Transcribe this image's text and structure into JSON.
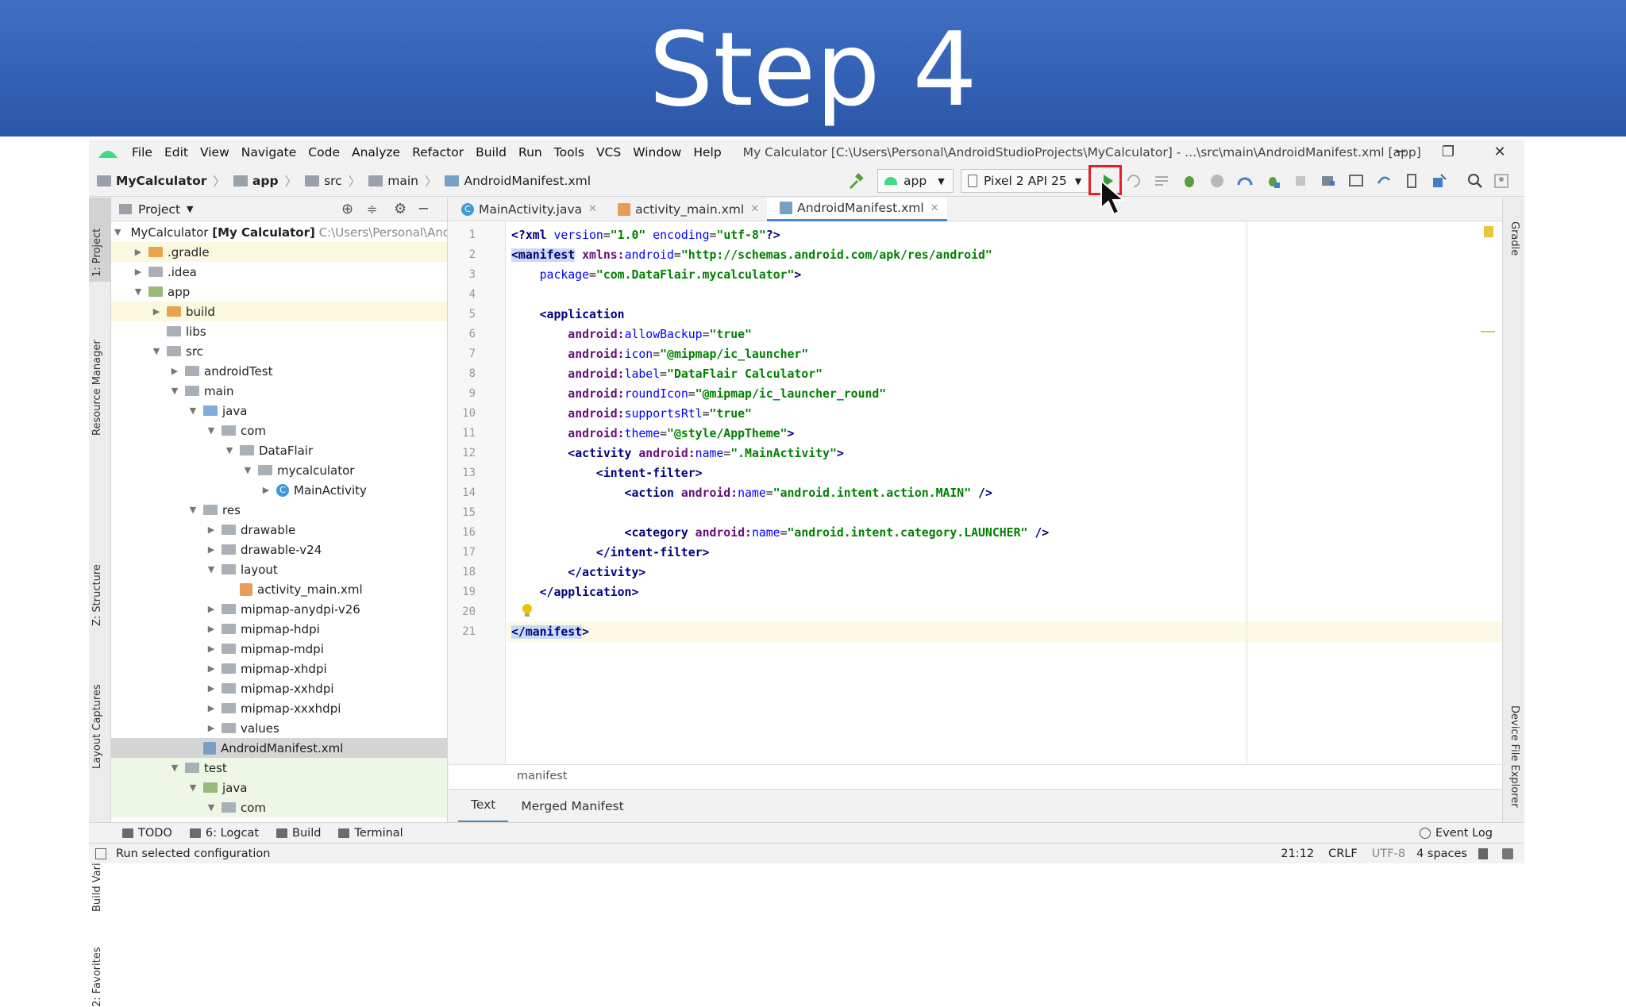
{
  "banner": {
    "title": "Step 4"
  },
  "menu": {
    "items": [
      "File",
      "Edit",
      "View",
      "Navigate",
      "Code",
      "Analyze",
      "Refactor",
      "Build",
      "Run",
      "Tools",
      "VCS",
      "Window",
      "Help"
    ],
    "window_title": "My Calculator [C:\\Users\\Personal\\AndroidStudioProjects\\MyCalculator] - ...\\src\\main\\AndroidManifest.xml [app]"
  },
  "navbar": {
    "crumbs": [
      "MyCalculator",
      "app",
      "src",
      "main",
      "AndroidManifest.xml"
    ],
    "run_config": "app",
    "device": "Pixel 2 API 25"
  },
  "tool_strips": {
    "left": [
      "1: Project",
      "Resource Manager",
      "Z: Structure",
      "Layout Captures",
      "Build Variants",
      "2: Favorites"
    ],
    "right": [
      "Gradle",
      "Device File Explorer"
    ]
  },
  "project": {
    "header": "Project",
    "root_name": "MyCalculator",
    "root_module": "[My Calculator]",
    "root_path": "C:\\Users\\Personal\\Andr",
    "tree": [
      {
        "name": ".gradle",
        "arrow": "▶",
        "depth": 1,
        "kind": "orange"
      },
      {
        "name": ".idea",
        "arrow": "▶",
        "depth": 1,
        "kind": "grey"
      },
      {
        "name": "app",
        "arrow": "▼",
        "depth": 1,
        "kind": "green"
      },
      {
        "name": "build",
        "arrow": "▶",
        "depth": 2,
        "kind": "orange"
      },
      {
        "name": "libs",
        "arrow": "",
        "depth": 2,
        "kind": "grey"
      },
      {
        "name": "src",
        "arrow": "▼",
        "depth": 2,
        "kind": "grey"
      },
      {
        "name": "androidTest",
        "arrow": "▶",
        "depth": 3,
        "kind": "grey"
      },
      {
        "name": "main",
        "arrow": "▼",
        "depth": 3,
        "kind": "grey"
      },
      {
        "name": "java",
        "arrow": "▼",
        "depth": 4,
        "kind": "blue"
      },
      {
        "name": "com",
        "arrow": "▼",
        "depth": 5,
        "kind": "grey"
      },
      {
        "name": "DataFlair",
        "arrow": "▼",
        "depth": 6,
        "kind": "grey"
      },
      {
        "name": "mycalculator",
        "arrow": "▼",
        "depth": 7,
        "kind": "grey"
      },
      {
        "name": "MainActivity",
        "arrow": "▶",
        "depth": 8,
        "kind": "class"
      },
      {
        "name": "res",
        "arrow": "▼",
        "depth": 4,
        "kind": "grey"
      },
      {
        "name": "drawable",
        "arrow": "▶",
        "depth": 5,
        "kind": "grey"
      },
      {
        "name": "drawable-v24",
        "arrow": "▶",
        "depth": 5,
        "kind": "grey"
      },
      {
        "name": "layout",
        "arrow": "▼",
        "depth": 5,
        "kind": "grey"
      },
      {
        "name": "activity_main.xml",
        "arrow": "",
        "depth": 6,
        "kind": "xml"
      },
      {
        "name": "mipmap-anydpi-v26",
        "arrow": "▶",
        "depth": 5,
        "kind": "grey"
      },
      {
        "name": "mipmap-hdpi",
        "arrow": "▶",
        "depth": 5,
        "kind": "grey"
      },
      {
        "name": "mipmap-mdpi",
        "arrow": "▶",
        "depth": 5,
        "kind": "grey"
      },
      {
        "name": "mipmap-xhdpi",
        "arrow": "▶",
        "depth": 5,
        "kind": "grey"
      },
      {
        "name": "mipmap-xxhdpi",
        "arrow": "▶",
        "depth": 5,
        "kind": "grey"
      },
      {
        "name": "mipmap-xxxhdpi",
        "arrow": "▶",
        "depth": 5,
        "kind": "grey"
      },
      {
        "name": "values",
        "arrow": "▶",
        "depth": 5,
        "kind": "grey"
      },
      {
        "name": "AndroidManifest.xml",
        "arrow": "",
        "depth": 4,
        "kind": "xml",
        "selected": true
      },
      {
        "name": "test",
        "arrow": "▼",
        "depth": 3,
        "kind": "grey"
      },
      {
        "name": "java",
        "arrow": "▼",
        "depth": 4,
        "kind": "green"
      },
      {
        "name": "com",
        "arrow": "▼",
        "depth": 5,
        "kind": "grey"
      }
    ]
  },
  "editor": {
    "tabs": [
      {
        "label": "MainActivity.java",
        "active": false
      },
      {
        "label": "activity_main.xml",
        "active": false
      },
      {
        "label": "AndroidManifest.xml",
        "active": true
      }
    ],
    "lines": [
      "<?xml version=\"1.0\" encoding=\"utf-8\"?>",
      "<manifest xmlns:android=\"http://schemas.android.com/apk/res/android\"",
      "    package=\"com.DataFlair.mycalculator\">",
      "",
      "    <application",
      "        android:allowBackup=\"true\"",
      "        android:icon=\"@mipmap/ic_launcher\"",
      "        android:label=\"DataFlair Calculator\"",
      "        android:roundIcon=\"@mipmap/ic_launcher_round\"",
      "        android:supportsRtl=\"true\"",
      "        android:theme=\"@style/AppTheme\">",
      "        <activity android:name=\".MainActivity\">",
      "            <intent-filter>",
      "                <action android:name=\"android.intent.action.MAIN\" />",
      "",
      "                <category android:name=\"android.intent.category.LAUNCHER\" />",
      "            </intent-filter>",
      "        </activity>",
      "    </application>",
      "",
      "</manifest>"
    ],
    "breadcrumb": "manifest",
    "bottom_tabs": [
      "Text",
      "Merged Manifest"
    ]
  },
  "tool_windows": [
    "TODO",
    "6: Logcat",
    "Build",
    "Terminal"
  ],
  "event_log": "Event Log",
  "status": {
    "message": "Run selected configuration",
    "position": "21:12",
    "line_sep": "CRLF",
    "encoding": "UTF-8",
    "indent": "4 spaces"
  },
  "colors": {
    "banner": "#2f5bb0",
    "run_highlight": "#e0202a",
    "accent": "#4a88c7"
  }
}
